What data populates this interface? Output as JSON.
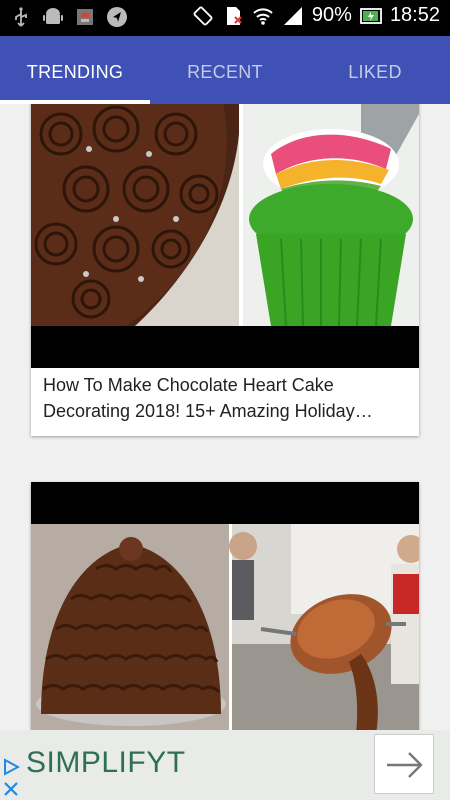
{
  "statusbar": {
    "battery": "90%",
    "time": "18:52",
    "icons": [
      "usb-icon",
      "android-icon",
      "sim-alert-icon",
      "navigation-icon",
      "rotate-icon",
      "no-sim-icon",
      "wifi-icon",
      "signal-icon",
      "battery-icon"
    ]
  },
  "tabs": [
    {
      "label": "TRENDING",
      "active": true
    },
    {
      "label": "RECENT",
      "active": false
    },
    {
      "label": "LIKED",
      "active": false
    }
  ],
  "cards": [
    {
      "title": "How To Make Chocolate Heart Cake Decorating 2018! 15+ Amazing Holiday…"
    }
  ],
  "ad": {
    "brand": "SIMPLIFYT",
    "icons": [
      "play-triangle-icon",
      "close-icon",
      "arrow-right-icon"
    ]
  },
  "colors": {
    "tabbar": "#3f51b5",
    "ad_text": "#2f6f55"
  }
}
